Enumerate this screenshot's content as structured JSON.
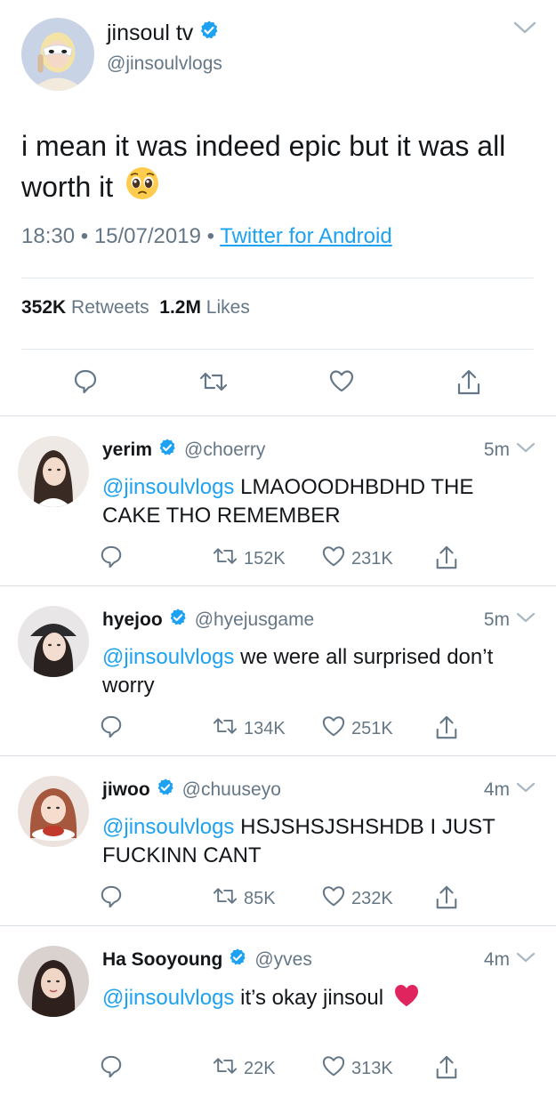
{
  "tweet": {
    "display_name": "jinsoul tv",
    "handle": "@jinsoulvlogs",
    "text": "i mean it was indeed epic but it was all worth it",
    "time": "18:30",
    "date": "15/07/2019",
    "separator": "•",
    "source": "Twitter for Android",
    "retweets_count": "352K",
    "retweets_label": "Retweets",
    "likes_count": "1.2M",
    "likes_label": "Likes"
  },
  "replies": [
    {
      "display_name": "yerim",
      "handle": "@choerry",
      "time": "5m",
      "mention": "@jinsoulvlogs",
      "text": "LMAOOODHBDHD THE CAKE THO REMEMBER",
      "retweets": "152K",
      "likes": "231K"
    },
    {
      "display_name": "hyejoo",
      "handle": "@hyejusgame",
      "time": "5m",
      "mention": "@jinsoulvlogs",
      "text": "we were all surprised don’t worry",
      "retweets": "134K",
      "likes": "251K"
    },
    {
      "display_name": "jiwoo",
      "handle": "@chuuseyo",
      "time": "4m",
      "mention": "@jinsoulvlogs",
      "text": "HSJSHSJSHSHDB I JUST FUCKINN CANT",
      "retweets": "85K",
      "likes": "232K"
    },
    {
      "display_name": "Ha Sooyoung",
      "handle": "@yves",
      "time": "4m",
      "mention": "@jinsoulvlogs",
      "text": "it’s okay jinsoul",
      "retweets": "22K",
      "likes": "313K"
    }
  ],
  "colors": {
    "accent": "#1da1f2",
    "secondary_text": "#657786",
    "primary_text": "#14171a",
    "heart_emoji": "#e0245e"
  },
  "icons": [
    "verified-badge-icon",
    "chevron-down-icon",
    "reply-icon",
    "retweet-icon",
    "like-icon",
    "share-icon",
    "pleading-face-emoji",
    "red-heart-emoji"
  ]
}
